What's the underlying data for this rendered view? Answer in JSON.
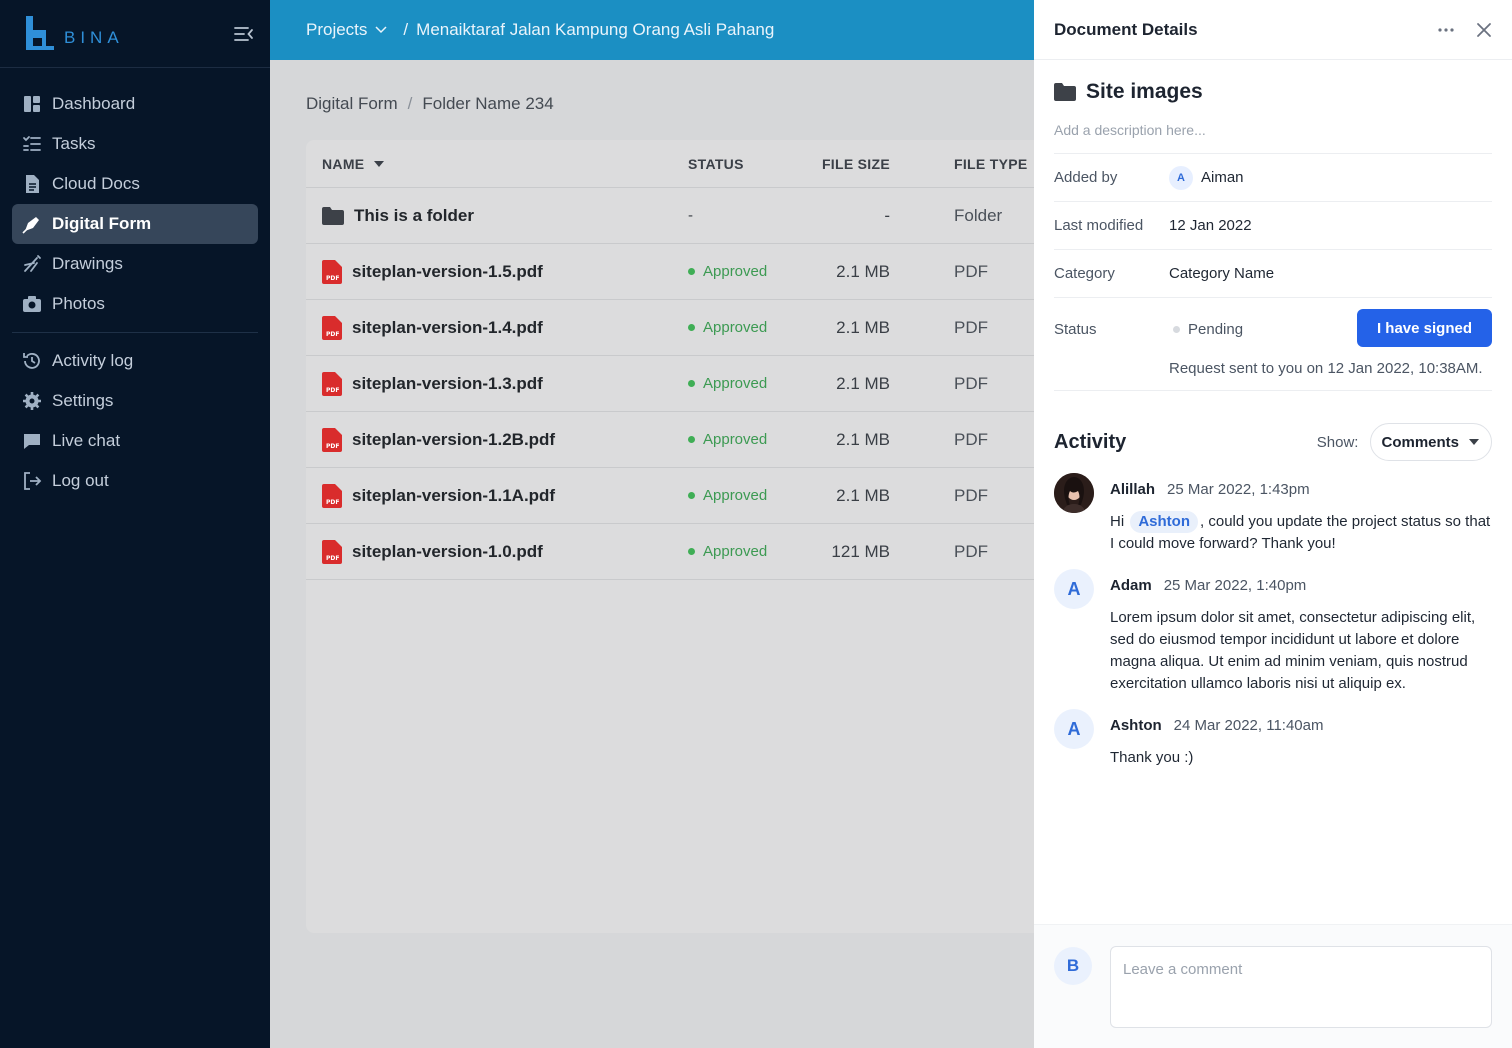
{
  "brand": {
    "name": "BINA"
  },
  "sidebar": {
    "items": [
      {
        "label": "Dashboard",
        "icon": "dashboard-icon"
      },
      {
        "label": "Tasks",
        "icon": "tasks-icon"
      },
      {
        "label": "Cloud Docs",
        "icon": "document-icon"
      },
      {
        "label": "Digital Form",
        "icon": "pen-icon",
        "active": true
      },
      {
        "label": "Drawings",
        "icon": "drawing-icon"
      },
      {
        "label": "Photos",
        "icon": "camera-icon"
      },
      {
        "label": "Activity log",
        "icon": "history-icon"
      },
      {
        "label": "Settings",
        "icon": "gear-icon"
      },
      {
        "label": "Live chat",
        "icon": "chat-icon"
      },
      {
        "label": "Log out",
        "icon": "logout-icon"
      }
    ]
  },
  "topbar": {
    "projects_label": "Projects",
    "separator": "/",
    "project_name": "Menaiktaraf Jalan Kampung Orang Asli Pahang",
    "color": "#1b8fc3"
  },
  "breadcrumb": {
    "root": "Digital Form",
    "separator": "/",
    "current": "Folder Name 234"
  },
  "table": {
    "columns": {
      "name": "NAME",
      "status": "STATUS",
      "size": "FILE SIZE",
      "type": "FILE TYPE"
    },
    "rows": [
      {
        "name": "This is a folder",
        "status": "-",
        "size": "-",
        "type": "Folder",
        "icon": "folder-icon"
      },
      {
        "name": "siteplan-version-1.5.pdf",
        "status": "Approved",
        "size": "2.1 MB",
        "type": "PDF",
        "icon": "pdf-icon"
      },
      {
        "name": "siteplan-version-1.4.pdf",
        "status": "Approved",
        "size": "2.1 MB",
        "type": "PDF",
        "icon": "pdf-icon"
      },
      {
        "name": "siteplan-version-1.3.pdf",
        "status": "Approved",
        "size": "2.1 MB",
        "type": "PDF",
        "icon": "pdf-icon"
      },
      {
        "name": "siteplan-version-1.2B.pdf",
        "status": "Approved",
        "size": "2.1 MB",
        "type": "PDF",
        "icon": "pdf-icon"
      },
      {
        "name": "siteplan-version-1.1A.pdf",
        "status": "Approved",
        "size": "2.1 MB",
        "type": "PDF",
        "icon": "pdf-icon"
      },
      {
        "name": "siteplan-version-1.0.pdf",
        "status": "Approved",
        "size": "121 MB",
        "type": "PDF",
        "icon": "pdf-icon"
      }
    ]
  },
  "panel": {
    "title": "Document Details",
    "doc_name": "Site images",
    "description_placeholder": "Add a description here...",
    "added_by_label": "Added by",
    "added_by_initial": "A",
    "added_by_name": "Aiman",
    "last_modified_label": "Last modified",
    "last_modified_value": "12 Jan 2022",
    "category_label": "Category",
    "category_value": "Category Name",
    "status_label": "Status",
    "status_value": "Pending",
    "sign_button": "I have signed",
    "request_note": "Request sent to you on 12 Jan 2022, 10:38AM.",
    "accent_color": "#2462e8"
  },
  "activity": {
    "title": "Activity",
    "show_label": "Show:",
    "filter_value": "Comments",
    "comments": [
      {
        "author": "Alillah",
        "time": "25 Mar 2022, 1:43pm",
        "avatar": "photo",
        "pre": "Hi",
        "mention": "Ashton",
        "post": ", could you update the project status so that I could move forward? Thank you!"
      },
      {
        "author": "Adam",
        "time": "25 Mar 2022, 1:40pm",
        "avatar": "A",
        "text": "Lorem ipsum dolor sit amet, consectetur adipiscing elit, sed do eiusmod tempor incididunt ut labore et dolore magna aliqua. Ut enim ad minim veniam, quis nostrud exercitation ullamco laboris nisi ut aliquip ex."
      },
      {
        "author": "Ashton",
        "time": "24 Mar 2022, 11:40am",
        "avatar": "A",
        "text": "Thank you :)"
      }
    ]
  },
  "composer": {
    "avatar": "B",
    "placeholder": "Leave a comment"
  }
}
